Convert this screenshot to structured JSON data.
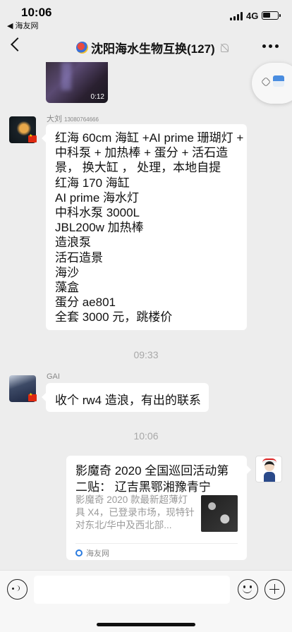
{
  "status_bar": {
    "time": "10:06",
    "back_app": "◀ 海友网",
    "network": "4G"
  },
  "nav": {
    "title": "沈阳海水生物互换(127)"
  },
  "video": {
    "duration": "0:12"
  },
  "messages": [
    {
      "sender": "大刘",
      "sender_id": "13080764666",
      "lines": [
        "红海 60cm 海缸 +AI prime 珊瑚灯 +",
        "中科泵 + 加热棒 + 蛋分 + 活石造",
        "景， 换大缸 ， 处理，本地自提",
        "红海 170 海缸",
        "AI prime 海水灯",
        "中科水泵 3000L",
        "JBL200w 加热棒",
        "造浪泵",
        "活石造景",
        "海沙",
        "藻盒",
        "蛋分 ae801",
        "全套 3000 元，跳楼价"
      ]
    },
    {
      "sender": "GAI",
      "text": "收个 rw4 造浪，有出的联系"
    }
  ],
  "timestamps": [
    "09:33",
    "10:06"
  ],
  "link_card": {
    "title": "影魔奇 2020 全国巡回活动第二贴： 辽吉黑鄂湘豫青宁",
    "description": "影魔奇 2020 款最新超薄灯具 X4，已登录市场，现特针对东北/华中及西北部...",
    "source": "海友网"
  }
}
